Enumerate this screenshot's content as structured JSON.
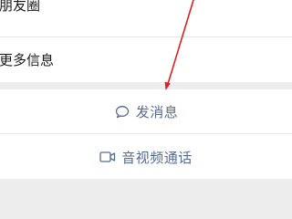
{
  "profile_rows": [
    {
      "label": "朋友圈"
    },
    {
      "label": "更多信息"
    }
  ],
  "actions": [
    {
      "label": "发消息",
      "icon": "chat-bubble-icon"
    },
    {
      "label": "音视频通话",
      "icon": "video-camera-icon"
    }
  ],
  "colors": {
    "link": "#576b95",
    "annotation_arrow": "#e02020",
    "background": "#ededed",
    "card": "#ffffff"
  }
}
